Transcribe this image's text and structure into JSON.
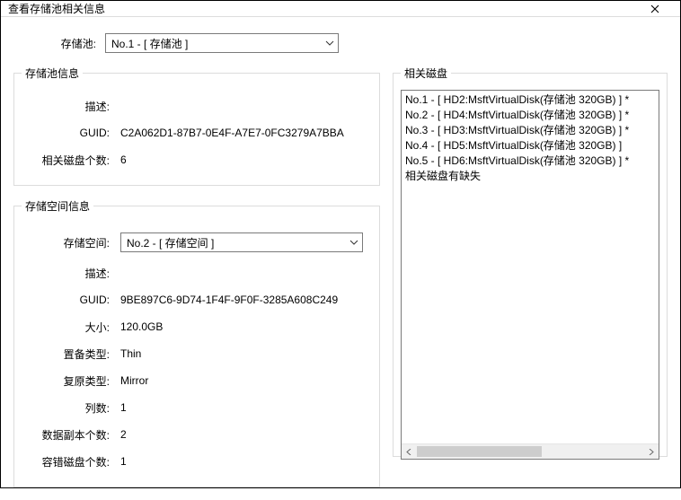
{
  "window": {
    "title": "查看存储池相关信息"
  },
  "pool_selector": {
    "label": "存储池:",
    "selected": "No.1 - [ 存储池 ]"
  },
  "pool_info": {
    "legend": "存储池信息",
    "rows": {
      "desc_label": "描述:",
      "desc_value": "",
      "guid_label": "GUID:",
      "guid_value": "C2A062D1-87B7-0E4F-A7E7-0FC3279A7BBA",
      "disk_count_label": "相关磁盘个数:",
      "disk_count_value": "6"
    }
  },
  "space_info": {
    "legend": "存储空间信息",
    "space_selector": {
      "label": "存储空间:",
      "selected": "No.2 - [ 存储空间 ]"
    },
    "rows": {
      "desc_label": "描述:",
      "desc_value": "",
      "guid_label": "GUID:",
      "guid_value": "9BE897C6-9D74-1F4F-9F0F-3285A608C249",
      "size_label": "大小:",
      "size_value": "120.0GB",
      "prov_label": "置备类型:",
      "prov_value": "Thin",
      "resil_label": "复原类型:",
      "resil_value": "Mirror",
      "cols_label": "列数:",
      "cols_value": "1",
      "copies_label": "数据副本个数:",
      "copies_value": "2",
      "tolerate_label": "容错磁盘个数:",
      "tolerate_value": "1"
    }
  },
  "related_disks": {
    "legend": "相关磁盘",
    "items": [
      "No.1 - [ HD2:MsftVirtualDisk(存储池 320GB) ] *",
      "No.2 - [ HD4:MsftVirtualDisk(存储池 320GB) ] *",
      "No.3 - [ HD3:MsftVirtualDisk(存储池 320GB) ] *",
      "No.4 - [ HD5:MsftVirtualDisk(存储池 320GB) ]",
      "No.5 - [ HD6:MsftVirtualDisk(存储池 320GB) ] *",
      "相关磁盘有缺失"
    ]
  }
}
